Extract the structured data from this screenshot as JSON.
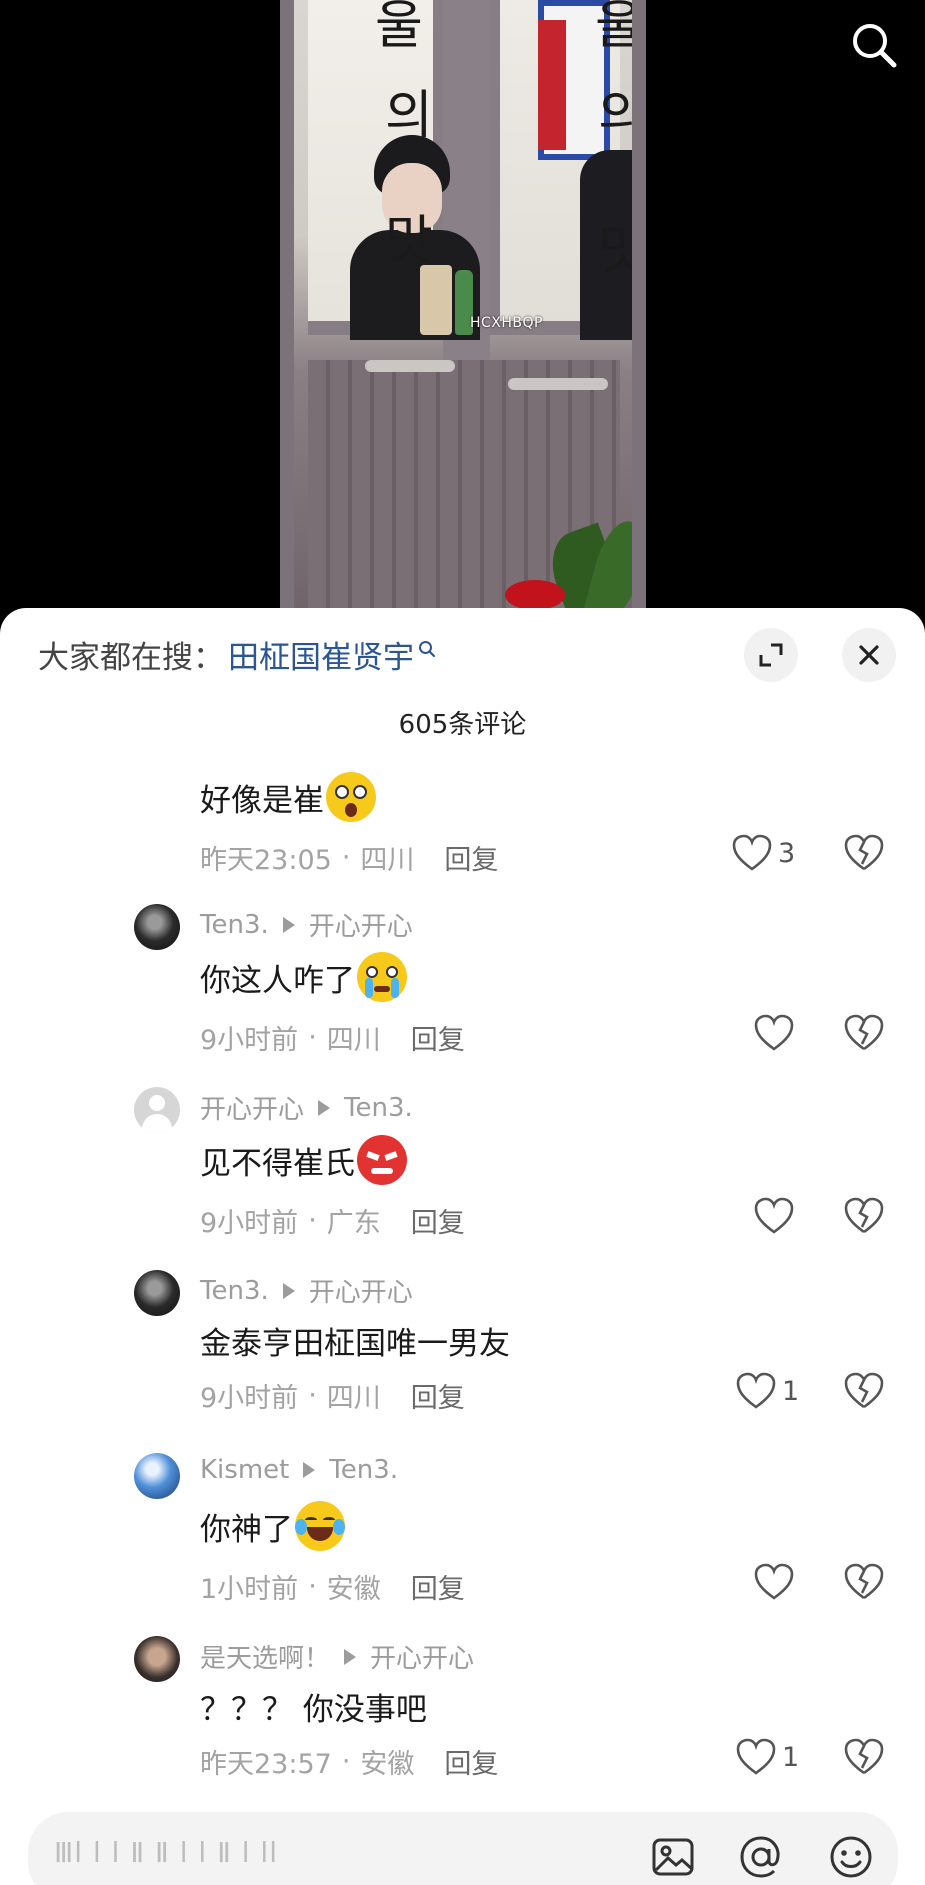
{
  "video": {
    "watermark": "HCXHBQP",
    "sign_chars_left": [
      "울",
      "의",
      "맛"
    ],
    "sign_chars_right": [
      "울",
      "의",
      "맛"
    ]
  },
  "header": {
    "hot_search_label": "大家都在搜：",
    "hot_search_term": "田柾国崔贤宇",
    "comment_count": "605条评论"
  },
  "comments": [
    {
      "text": "好像是崔",
      "emoji": "shocked-face-emoji",
      "time": "昨天23:05",
      "location": "四川",
      "reply_label": "回复",
      "likes": "3"
    },
    {
      "author": "Ten3.",
      "reply_to": "开心开心",
      "avatar": "dark-avatar",
      "text": "你这人咋了",
      "emoji": "crying-face-emoji",
      "time": "9小时前",
      "location": "四川",
      "reply_label": "回复",
      "likes": ""
    },
    {
      "author": "开心开心",
      "reply_to": "Ten3.",
      "avatar": "default-avatar",
      "text": "见不得崔氏",
      "emoji": "angry-face-emoji",
      "time": "9小时前",
      "location": "广东",
      "reply_label": "回复",
      "likes": ""
    },
    {
      "author": "Ten3.",
      "reply_to": "开心开心",
      "avatar": "dark-avatar",
      "text": "金泰亨田柾国唯一男友",
      "emoji": "",
      "time": "9小时前",
      "location": "四川",
      "reply_label": "回复",
      "likes": "1"
    },
    {
      "author": "Kismet",
      "reply_to": "Ten3.",
      "avatar": "blue-avatar",
      "text": "你神了",
      "emoji": "laugh-cry-face-emoji",
      "time": "1小时前",
      "location": "安徽",
      "reply_label": "回复",
      "likes": ""
    },
    {
      "author": "是天选啊！",
      "reply_to": "开心开心",
      "avatar": "photo-avatar",
      "text": "？？？ 你没事吧",
      "emoji": "",
      "time": "昨天23:57",
      "location": "安徽",
      "reply_label": "回复",
      "likes": "1"
    }
  ],
  "dot_separator": "·",
  "input": {
    "placeholder": "Ⅲl l l Ⅱ Ⅱ l l Ⅱ l ll"
  },
  "icons": {
    "top_search": "search-icon",
    "expand": "expand-icon",
    "close": "close-icon",
    "like": "heart-icon",
    "dislike": "broken-heart-icon",
    "image": "image-icon",
    "at": "at-icon",
    "emoji": "emoji-icon"
  },
  "colors": {
    "link_blue": "#2b5691",
    "meta_gray": "#a3a3a3",
    "sheet_bg": "#ffffff"
  }
}
